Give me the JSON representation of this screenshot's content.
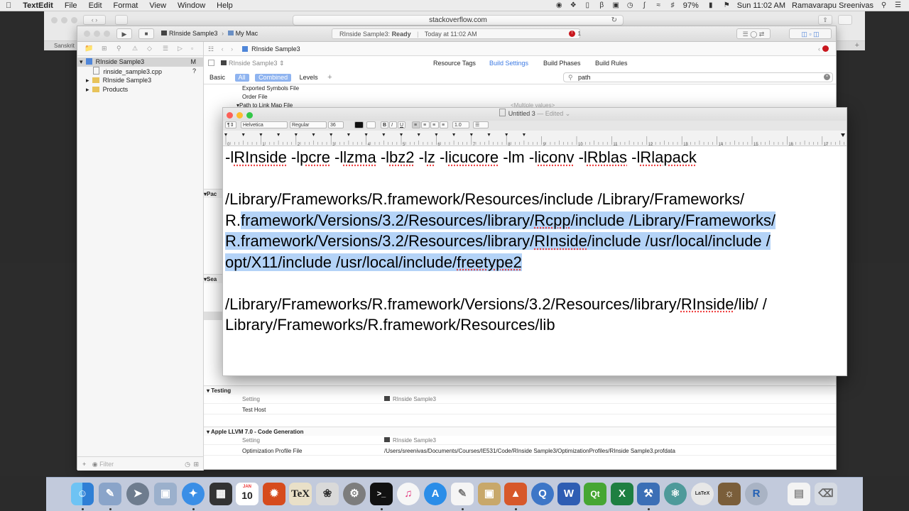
{
  "menubar": {
    "app_name": "TextEdit",
    "items": [
      "File",
      "Edit",
      "Format",
      "View",
      "Window",
      "Help"
    ],
    "battery": "97%",
    "clock": "Sun 11:02 AM",
    "user": "Ramavarapu Sreenivas"
  },
  "safari": {
    "url": "stackoverflow.com",
    "tab_partial": "Sanskrit"
  },
  "xcode": {
    "scheme": "RInside Sample3",
    "destination": "My Mac",
    "status_project": "RInside Sample3:",
    "status_state": "Ready",
    "status_time": "Today at 11:02 AM",
    "issue_count": "1",
    "navigator": {
      "items": [
        {
          "label": "RInside Sample3",
          "badge": "M"
        },
        {
          "label": "rinside_sample3.cpp",
          "badge": "?"
        },
        {
          "label": "RInside Sample3",
          "badge": ""
        },
        {
          "label": "Products",
          "badge": ""
        }
      ],
      "filter_placeholder": "Filter"
    },
    "jump_bar": "RInside Sample3",
    "target_popup": "RInside Sample3",
    "tabs": [
      "Resource Tags",
      "Build Settings",
      "Build Phases",
      "Build Rules"
    ],
    "scope": {
      "basic": "Basic",
      "all": "All",
      "combined": "Combined",
      "levels": "Levels"
    },
    "search_value": "path",
    "rows_top": [
      "Exported Symbols File",
      "Order File",
      "Path to Link Map File"
    ],
    "multiple_values": "<Multiple values>",
    "partial_headers": [
      "Pac",
      "Sea"
    ],
    "testing": {
      "header": "Testing",
      "setting_label": "Setting",
      "target": "RInside Sample3",
      "host": "Test Host"
    },
    "codegen": {
      "header": "Apple LLVM 7.0 - Code Generation",
      "setting_label": "Setting",
      "target": "RInside Sample3",
      "opt_label": "Optimization Profile File",
      "opt_value": "/Users/sreenivas/Documents/Courses/IE531/Code/RInside Sample3/OptimizationProfiles/RInside Sample3.profdata"
    }
  },
  "textedit": {
    "title": "Untitled 3",
    "edited": "— Edited",
    "font_family": "Helvetica",
    "font_style": "Regular",
    "font_size": "36",
    "line_spacing": "1.0",
    "ruler_ticks": [
      "0",
      "1",
      "2",
      "3",
      "4",
      "5",
      "6",
      "7",
      "8",
      "9",
      "10",
      "11",
      "12",
      "13",
      "14",
      "15",
      "16",
      "17"
    ],
    "line1": {
      "t1": "-l",
      "s1": "RInside",
      "t2": " -l",
      "s2": "pcre",
      "t3": " -l",
      "s3": "lzma",
      "t4": " -l",
      "s4": "bz2",
      "t5": " -l",
      "s5": "z",
      "t6": " -l",
      "s6": "icucore",
      "t7": " -lm -l",
      "s7": "iconv",
      "t8": " -l",
      "s8": "Rblas",
      "t9": " -l",
      "s9": "Rlapack"
    },
    "para2": {
      "pre": "/Library/Frameworks/R.framework/Resources/include /Library/Frameworks/ R.",
      "sel_a": "framework/Versions/3.2/Resources/library/",
      "sq1": "Rcpp",
      "sel_b": "/include /Library/Frameworks/ R.framework/Versions/3.2/Resources/library/",
      "sq2": "RInside",
      "sel_c": "/include /usr/local/include / opt/X11/include /usr/local/include/",
      "sq3": "freetype2"
    },
    "para3": {
      "pre": "/Library/Frameworks/R.framework/Versions/3.2/Resources/library/",
      "sq": "RInside",
      "post": "/lib/ / Library/Frameworks/R.framework/Resources/lib"
    }
  },
  "dock": {
    "calendar_month": "JAN",
    "calendar_day": "10",
    "icons": [
      "finder-icon",
      "preview-icon",
      "launchpad-icon",
      "photo-icon",
      "safari-icon",
      "photobooth-icon",
      "calendar-icon",
      "mathematica-icon",
      "texshop-icon",
      "sketch-icon",
      "system-preferences-icon",
      "terminal-icon",
      "itunes-icon",
      "app-store-icon",
      "textedit-icon",
      "preview-edit-icon",
      "matlab-icon",
      "qvt-icon",
      "word-icon",
      "qt-icon",
      "excel-icon",
      "xcode-icon",
      "ruby-icon",
      "latex-icon",
      "gnu-icon",
      "r-icon",
      "document-icon",
      "trash-icon"
    ]
  }
}
